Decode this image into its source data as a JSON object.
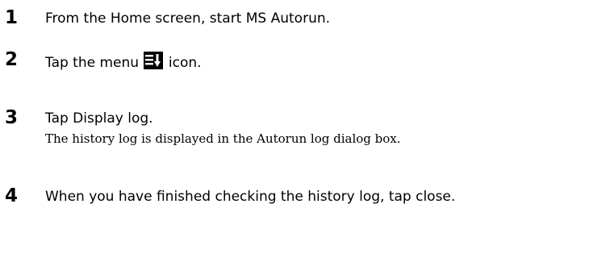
{
  "steps": [
    {
      "number": "1",
      "text": "From the Home screen, start MS Autorun."
    },
    {
      "number": "2",
      "text_before": "Tap the menu",
      "icon": "menu-icon",
      "text_after": "icon."
    },
    {
      "number": "3",
      "text": "Tap Display log.",
      "note": "The history log is displayed in the Autorun log dialog box."
    },
    {
      "number": "4",
      "text": "When you have finished checking the history log, tap close."
    }
  ]
}
